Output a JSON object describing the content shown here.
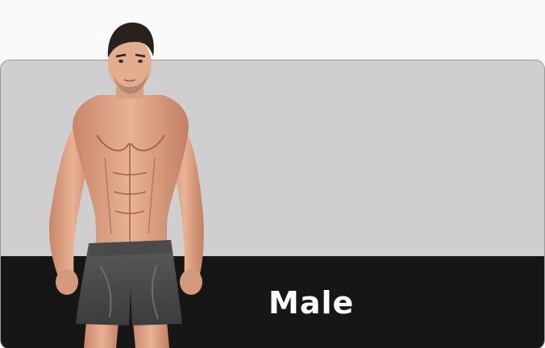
{
  "option": {
    "label": "Male",
    "illustration": "male-figure-illustration"
  },
  "colors": {
    "page_background": "#fafafa",
    "card_top": "#cfcfd0",
    "card_bottom": "#161616",
    "label_text": "#ffffff"
  }
}
